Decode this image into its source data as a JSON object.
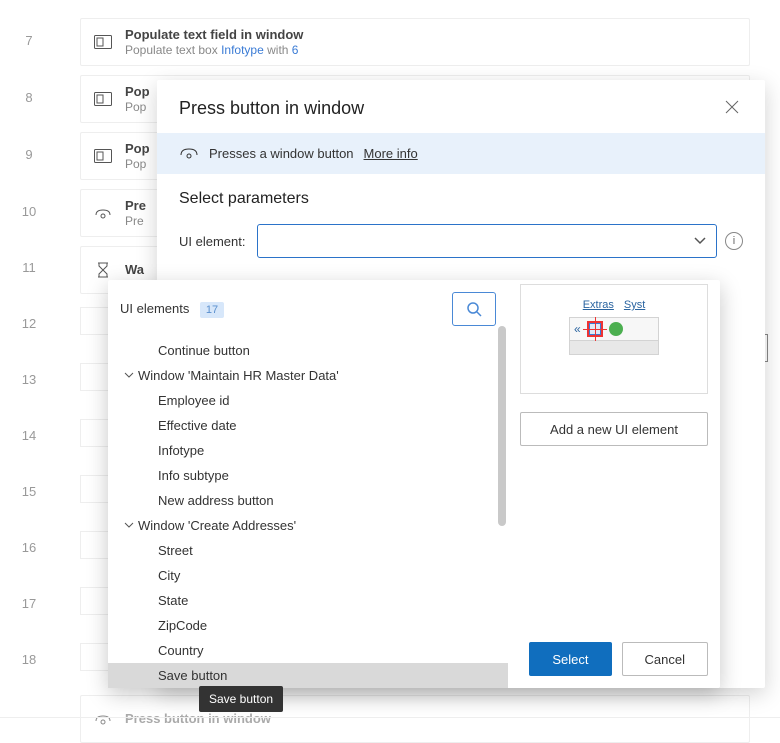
{
  "steps": [
    {
      "num": "7",
      "title": "Populate text field in window",
      "sub_pre": "Populate text box ",
      "sub_hl1": "Infotype",
      "sub_mid": " with ",
      "sub_hl2": "6",
      "icon": "textbox"
    },
    {
      "num": "8",
      "title": "Pop",
      "sub_pre": "Pop",
      "icon": "textbox"
    },
    {
      "num": "9",
      "title": "Pop",
      "sub_pre": "Pop",
      "icon": "textbox"
    },
    {
      "num": "10",
      "title": "Pre",
      "sub_pre": "Pre",
      "icon": "press"
    },
    {
      "num": "11",
      "title": "Wa",
      "icon": "wait"
    },
    {
      "num": "12"
    },
    {
      "num": "13"
    },
    {
      "num": "14"
    },
    {
      "num": "15"
    },
    {
      "num": "16"
    },
    {
      "num": "17"
    },
    {
      "num": "18"
    }
  ],
  "bottom_card_title": "Press button in window",
  "modal": {
    "title": "Press button in window",
    "info_desc": "Presses a window button",
    "info_link": "More info",
    "section_title": "Select parameters",
    "field_label": "UI element:"
  },
  "picker": {
    "heading": "UI elements",
    "count": "17",
    "add_label": "Add a new UI element",
    "select_label": "Select",
    "cancel_label": "Cancel",
    "preview_menu": [
      "Extras",
      "Syst"
    ],
    "tree": [
      {
        "type": "child",
        "label": "Continue button"
      },
      {
        "type": "parent",
        "label": "Window 'Maintain HR Master Data'"
      },
      {
        "type": "child",
        "label": "Employee id"
      },
      {
        "type": "child",
        "label": "Effective date"
      },
      {
        "type": "child",
        "label": "Infotype"
      },
      {
        "type": "child",
        "label": "Info subtype"
      },
      {
        "type": "child",
        "label": "New address button"
      },
      {
        "type": "parent",
        "label": "Window 'Create Addresses'"
      },
      {
        "type": "child",
        "label": "Street"
      },
      {
        "type": "child",
        "label": "City"
      },
      {
        "type": "child",
        "label": "State"
      },
      {
        "type": "child",
        "label": "ZipCode"
      },
      {
        "type": "child",
        "label": "Country"
      },
      {
        "type": "child",
        "label": "Save button",
        "selected": true
      }
    ]
  },
  "tooltip": "Save button"
}
